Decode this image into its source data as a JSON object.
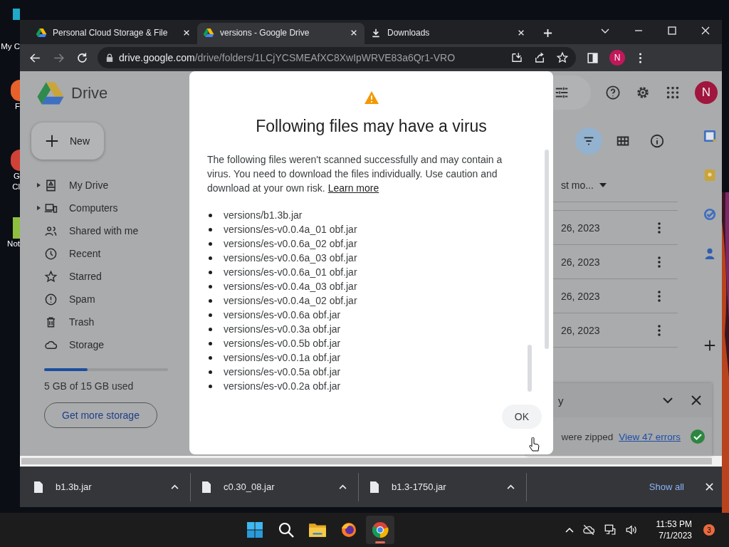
{
  "desktop_icons": [
    {
      "lines": [
        "My C"
      ]
    },
    {
      "lines": [
        "F"
      ]
    },
    {
      "lines": [
        "G",
        "Cl"
      ]
    },
    {
      "lines": [
        "Not"
      ]
    }
  ],
  "browser": {
    "tabs": [
      {
        "title": "Personal Cloud Storage & File",
        "kind": "drive",
        "selected": false
      },
      {
        "title": "versions - Google Drive",
        "kind": "drive",
        "selected": true
      },
      {
        "title": "Downloads",
        "kind": "download",
        "selected": false
      }
    ],
    "forward_disabled": true,
    "address": {
      "host": "drive.google.com",
      "path": "/drive/folders/1LCjYCSMEAfXC8XwIpWRVE83a6Qr1-VRO"
    },
    "profile": "N"
  },
  "drive": {
    "logo": "Drive",
    "new_button": "New",
    "nav": [
      {
        "label": "My Drive",
        "kind": "drive",
        "expandable": true
      },
      {
        "label": "Computers",
        "kind": "computers",
        "expandable": true
      },
      {
        "label": "Shared with me",
        "kind": "shared",
        "expandable": false
      },
      {
        "label": "Recent",
        "kind": "recent",
        "expandable": false
      },
      {
        "label": "Starred",
        "kind": "starred",
        "expandable": false
      },
      {
        "label": "Spam",
        "kind": "spam",
        "expandable": false
      },
      {
        "label": "Trash",
        "kind": "trash",
        "expandable": false
      },
      {
        "label": "Storage",
        "kind": "storage",
        "expandable": false
      }
    ],
    "storage": {
      "level": 0.35,
      "text": "5 GB of 15 GB used",
      "button": "Get more storage"
    },
    "avatar": "N",
    "view_buttons": [
      {
        "kind": "filter",
        "selected": true
      },
      {
        "kind": "grid",
        "selected": false
      },
      {
        "kind": "info",
        "selected": false
      }
    ],
    "sort_header": "st mo...",
    "rows": [
      {
        "date": "26, 2023"
      },
      {
        "date": "26, 2023"
      },
      {
        "date": "26, 2023"
      },
      {
        "date": "26, 2023"
      }
    ],
    "upload_panel": {
      "title": "y",
      "message": "were zipped",
      "link": "View 47 errors"
    }
  },
  "dialog": {
    "title": "Following files may have a virus",
    "body": "The following files weren't scanned successfully and may contain a virus. You need to download the files individually. Use caution and download at your own risk.",
    "link": "Learn more",
    "files": [
      "versions/b1.3b.jar",
      "versions/es-v0.0.4a_01 obf.jar",
      "versions/es-v0.0.6a_02 obf.jar",
      "versions/es-v0.0.6a_03 obf.jar",
      "versions/es-v0.0.6a_01 obf.jar",
      "versions/es-v0.0.4a_03 obf.jar",
      "versions/es-v0.0.4a_02 obf.jar",
      "versions/es-v0.0.6a obf.jar",
      "versions/es-v0.0.3a obf.jar",
      "versions/es-v0.0.5b obf.jar",
      "versions/es-v0.0.1a obf.jar",
      "versions/es-v0.0.5a obf.jar",
      "versions/es-v0.0.2a obf.jar"
    ],
    "ok": "OK"
  },
  "downloads": {
    "items": [
      {
        "name": "b1.3b.jar"
      },
      {
        "name": "c0.30_08.jar"
      },
      {
        "name": "b1.3-1750.jar"
      }
    ],
    "show_all": "Show all"
  },
  "taskbar": {
    "apps": [
      {
        "kind": "start",
        "selected": false
      },
      {
        "kind": "search",
        "selected": false
      },
      {
        "kind": "explorer",
        "selected": false
      },
      {
        "kind": "firefox",
        "selected": false
      },
      {
        "kind": "chrome",
        "selected": true
      }
    ],
    "time": "11:53 PM",
    "date": "7/1/2023",
    "badge": "3"
  }
}
